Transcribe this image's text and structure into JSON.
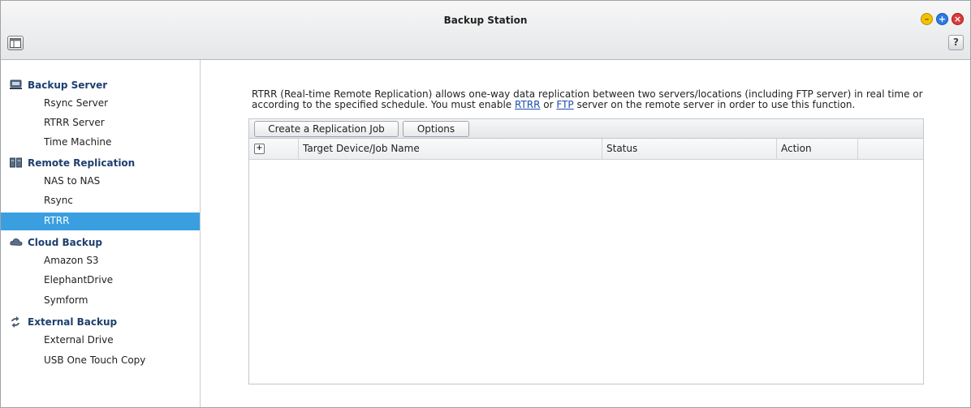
{
  "window": {
    "title": "Backup Station",
    "help_label": "?"
  },
  "sidebar": {
    "groups": [
      {
        "label": "Backup Server",
        "icon": "server-icon",
        "items": [
          {
            "label": "Rsync Server"
          },
          {
            "label": "RTRR Server"
          },
          {
            "label": "Time Machine"
          }
        ]
      },
      {
        "label": "Remote Replication",
        "icon": "replication-icon",
        "items": [
          {
            "label": "NAS to NAS"
          },
          {
            "label": "Rsync"
          },
          {
            "label": "RTRR",
            "selected": true
          }
        ]
      },
      {
        "label": "Cloud Backup",
        "icon": "cloud-icon",
        "items": [
          {
            "label": "Amazon S3"
          },
          {
            "label": "ElephantDrive"
          },
          {
            "label": "Symform"
          }
        ]
      },
      {
        "label": "External Backup",
        "icon": "sync-arrows-icon",
        "items": [
          {
            "label": "External Drive"
          },
          {
            "label": "USB One Touch Copy"
          }
        ]
      }
    ]
  },
  "main": {
    "description": {
      "part1": "RTRR (Real-time Remote Replication) allows one-way data replication between two servers/locations (including FTP server) in real time or according to the specified schedule. You must enable ",
      "link1": "RTRR",
      "part2": " or ",
      "link2": "FTP",
      "part3": " server on the remote server in order to use this function."
    },
    "toolbar": {
      "create_label": "Create a Replication Job",
      "options_label": "Options"
    },
    "table": {
      "expand_symbol": "+",
      "columns": [
        "Target Device/Job Name",
        "Status",
        "Action"
      ],
      "rows": []
    }
  },
  "colors": {
    "selected_item": "#3a9fe0",
    "group_heading": "#1d3f6e",
    "link": "#1a4fa8"
  }
}
